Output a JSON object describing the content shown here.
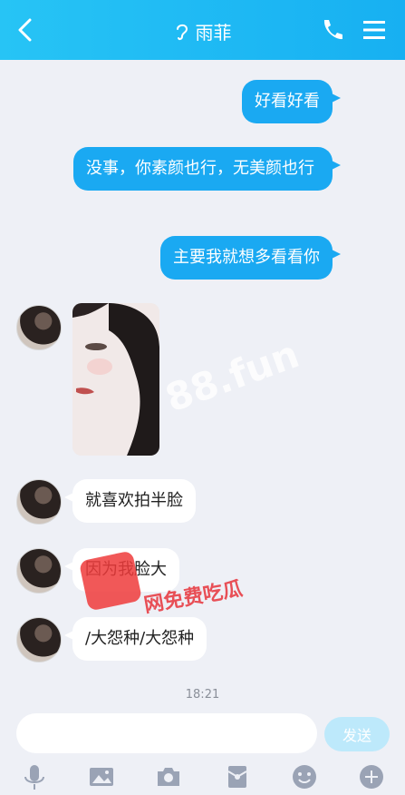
{
  "header": {
    "title": "雨菲",
    "accent": "#1aa9f2"
  },
  "messages": {
    "out1": "好看好看",
    "out2": "没事，你素颜也行，无美颜也行",
    "out3": "主要我就想多看看你",
    "in1": "就喜欢拍半脸",
    "in2": "因为我脸大",
    "in3": "/大怨种/大怨种",
    "time": "18:21"
  },
  "input": {
    "placeholder": "",
    "send_label": "发送"
  },
  "overlay": {
    "watermark": "88.fun",
    "promo_text": "网免费吃瓜"
  },
  "icons": [
    "back-icon",
    "ear-icon",
    "phone-icon",
    "menu-icon",
    "mic-icon",
    "image-icon",
    "camera-icon",
    "red-packet-icon",
    "emoji-icon",
    "plus-icon"
  ]
}
